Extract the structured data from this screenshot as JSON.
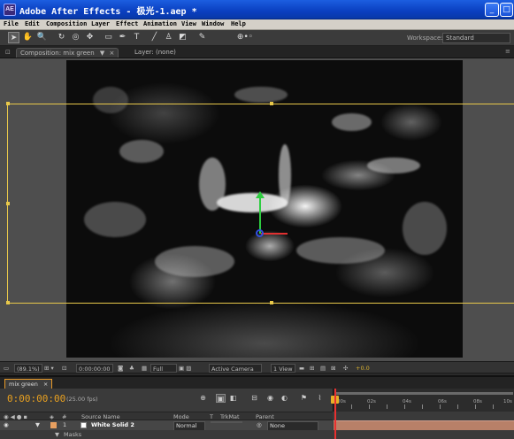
{
  "window": {
    "title": "Adobe After Effects - 极光-1.aep *",
    "app_icon": "AE",
    "minimize_label": "_",
    "maximize_label": "□"
  },
  "menu": [
    "File",
    "Edit",
    "Composition",
    "Layer",
    "Effect",
    "Animation",
    "View",
    "Window",
    "Help"
  ],
  "toolbar": {
    "workspace_label": "Workspace:",
    "workspace_value": "Standard",
    "tools": [
      "selection-tool-icon",
      "hand-tool-icon",
      "zoom-tool-icon",
      "rotation-tool-icon",
      "orbit-camera-icon",
      "track-xy-camera-icon",
      "rectangle-mask-icon",
      "pen-tool-icon",
      "text-tool-icon",
      "brush-tool-icon",
      "clone-stamp-icon",
      "eraser-tool-icon",
      "puppet-pin-icon",
      "axis-mode-icon"
    ]
  },
  "panels": {
    "comp_tab": "Composition: mix green",
    "layer_tab": "Layer: (none)"
  },
  "viewer_footer": {
    "magnification": "(89.1%)",
    "timecode": "0:00:00:00",
    "resolution": "Full",
    "camera": "Active Camera",
    "views": "1 View",
    "exposure": "+0.0"
  },
  "timeline": {
    "tab_label": "mix green",
    "timecode": "0:00:00:00",
    "fps": "(25.00 fps)",
    "ruler_labels": [
      "00s",
      "02s",
      "04s",
      "06s",
      "08s",
      "10s"
    ],
    "columns": {
      "number": "#",
      "source_name": "Source Name",
      "mode": "Mode",
      "t": "T",
      "trkmat": "TrkMat",
      "parent": "Parent"
    },
    "layer": {
      "index": "1",
      "name": "White Solid 2",
      "mode": "Normal",
      "parent": "None"
    },
    "masks_label": "Masks"
  },
  "colors": {
    "title_bar": "#0a3fc0",
    "layer_bounds": "#e8c84a",
    "timecode": "#e8a020",
    "layer_bar": "#b88068",
    "label_swatch": "#e8a060"
  }
}
